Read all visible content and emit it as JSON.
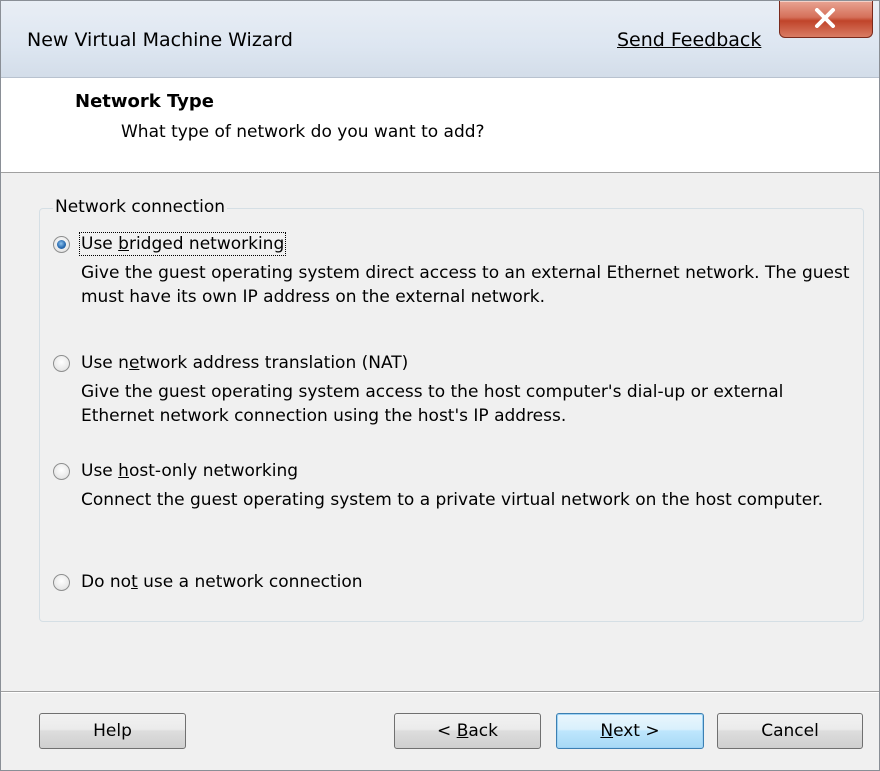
{
  "window": {
    "title": "New Virtual Machine Wizard",
    "send_feedback": "Send Feedback"
  },
  "header": {
    "title": "Network Type",
    "subtitle": "What type of network do you want to add?"
  },
  "network_connection": {
    "legend": "Network connection",
    "selected": "bridged",
    "options": [
      {
        "id": "bridged",
        "label_pre": "Use ",
        "label_key": "b",
        "label_post": "ridged networking",
        "description": "Give the guest operating system direct access to an external Ethernet network. The guest must have its own IP address on the external network."
      },
      {
        "id": "nat",
        "label_pre": "Use n",
        "label_key": "e",
        "label_post": "twork address translation (NAT)",
        "description": "Give the guest operating system access to the host computer's dial-up or external Ethernet network connection using the host's IP address."
      },
      {
        "id": "hostonly",
        "label_pre": "Use ",
        "label_key": "h",
        "label_post": "ost-only networking",
        "description": "Connect the guest operating system to a private virtual network on the host computer."
      },
      {
        "id": "none",
        "label_pre": "Do no",
        "label_key": "t",
        "label_post": " use a network connection",
        "description": ""
      }
    ]
  },
  "footer": {
    "help": "Help",
    "back_pre": "< ",
    "back_key": "B",
    "back_post": "ack",
    "next_pre": "",
    "next_key": "N",
    "next_post": "ext >",
    "cancel": "Cancel"
  }
}
